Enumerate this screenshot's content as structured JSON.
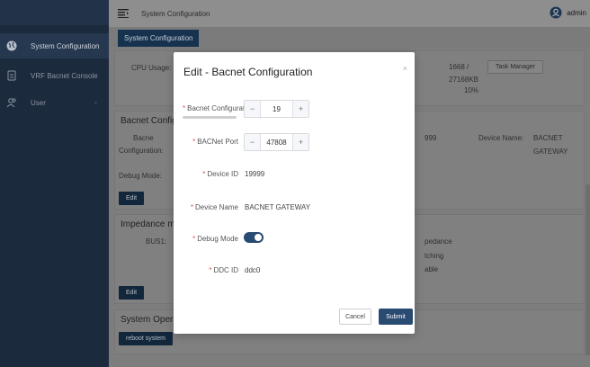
{
  "sidebar": {
    "items": [
      {
        "label": "System Configuration",
        "icon": "globe-icon",
        "active": true
      },
      {
        "label": "VRF Bacnet Console",
        "icon": "device-icon",
        "active": false
      },
      {
        "label": "User",
        "icon": "users-icon",
        "active": false
      }
    ]
  },
  "header": {
    "title": "System Configuration",
    "user": "admin"
  },
  "tabs": [
    {
      "label": "System Configuration"
    }
  ],
  "background": {
    "cpu_label": "CPU Usage:",
    "mem_value": "1668 /",
    "mem_total": "27168KB",
    "cpu_percent": "10%",
    "task_manager": "Task Manager",
    "bacnet_title": "Bacnet Configu",
    "bacne_label": "Bacne",
    "config_label": "Configuration:",
    "port_partial": "999",
    "device_name_label": "Device Name:",
    "device_name_val1": "BACNET",
    "device_name_val2": "GATEWAY",
    "debug_label": "Debug Mode:",
    "edit_label": "Edit",
    "impedance_title": "Impedance ma",
    "bus_label": "BUS1:",
    "imp1": "pedance",
    "imp2": "tching",
    "imp3": "able",
    "edit2_label": "Edit",
    "sysop_title": "System Operat",
    "reboot_label": "reboot system"
  },
  "modal": {
    "title": "Edit - Bacnet Configuration",
    "close": "×",
    "fields": {
      "bacnet_config": {
        "label": "Bacnet Configurat",
        "value": "19"
      },
      "bacnet_port": {
        "label": "BACNet Port",
        "value": "47808"
      },
      "device_id": {
        "label": "Device ID",
        "value": "19999"
      },
      "device_name": {
        "label": "Device Name",
        "value": "BACNET GATEWAY"
      },
      "debug_mode": {
        "label": "Debug Mode",
        "on": true
      },
      "ddc_id": {
        "label": "DDC ID",
        "value": "ddc0"
      }
    },
    "required_mark": "*",
    "cancel": "Cancel",
    "submit": "Submit"
  },
  "stepper": {
    "minus": "−",
    "plus": "+"
  },
  "colors": {
    "accent": "#294a71",
    "sidebar": "#1c2a3d",
    "required": "#e05050"
  }
}
